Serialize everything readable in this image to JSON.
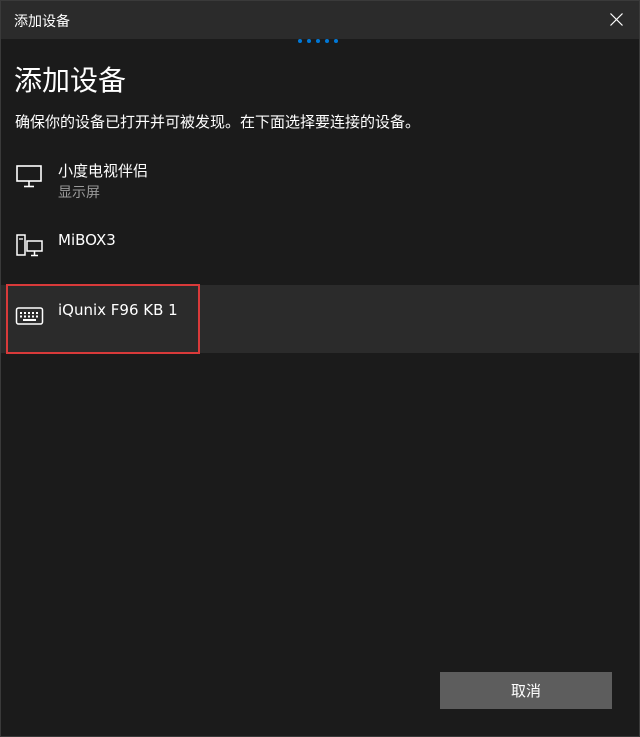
{
  "window": {
    "title": "添加设备"
  },
  "header": {
    "heading": "添加设备",
    "subtitle": "确保你的设备已打开并可被发现。在下面选择要连接的设备。"
  },
  "progress": {
    "dot_count": 5,
    "color": "#0078d7",
    "state": "indeterminate"
  },
  "devices": [
    {
      "name": "小度电视伴侣",
      "type": "显示屏",
      "icon": "monitor-icon",
      "selected": false
    },
    {
      "name": "MiBOX3",
      "type": "",
      "icon": "computer-display-icon",
      "selected": false
    },
    {
      "name": "iQunix F96 KB 1",
      "type": "",
      "icon": "keyboard-icon",
      "selected": true
    }
  ],
  "footer": {
    "cancel_label": "取消"
  },
  "colors": {
    "background": "#1b1b1b",
    "titlebar": "#2b2b2b",
    "selected_row": "#2b2b2b",
    "highlight_border": "#d93a3a",
    "button": "#5d5d5d",
    "secondary_text": "#9a9a9a"
  }
}
